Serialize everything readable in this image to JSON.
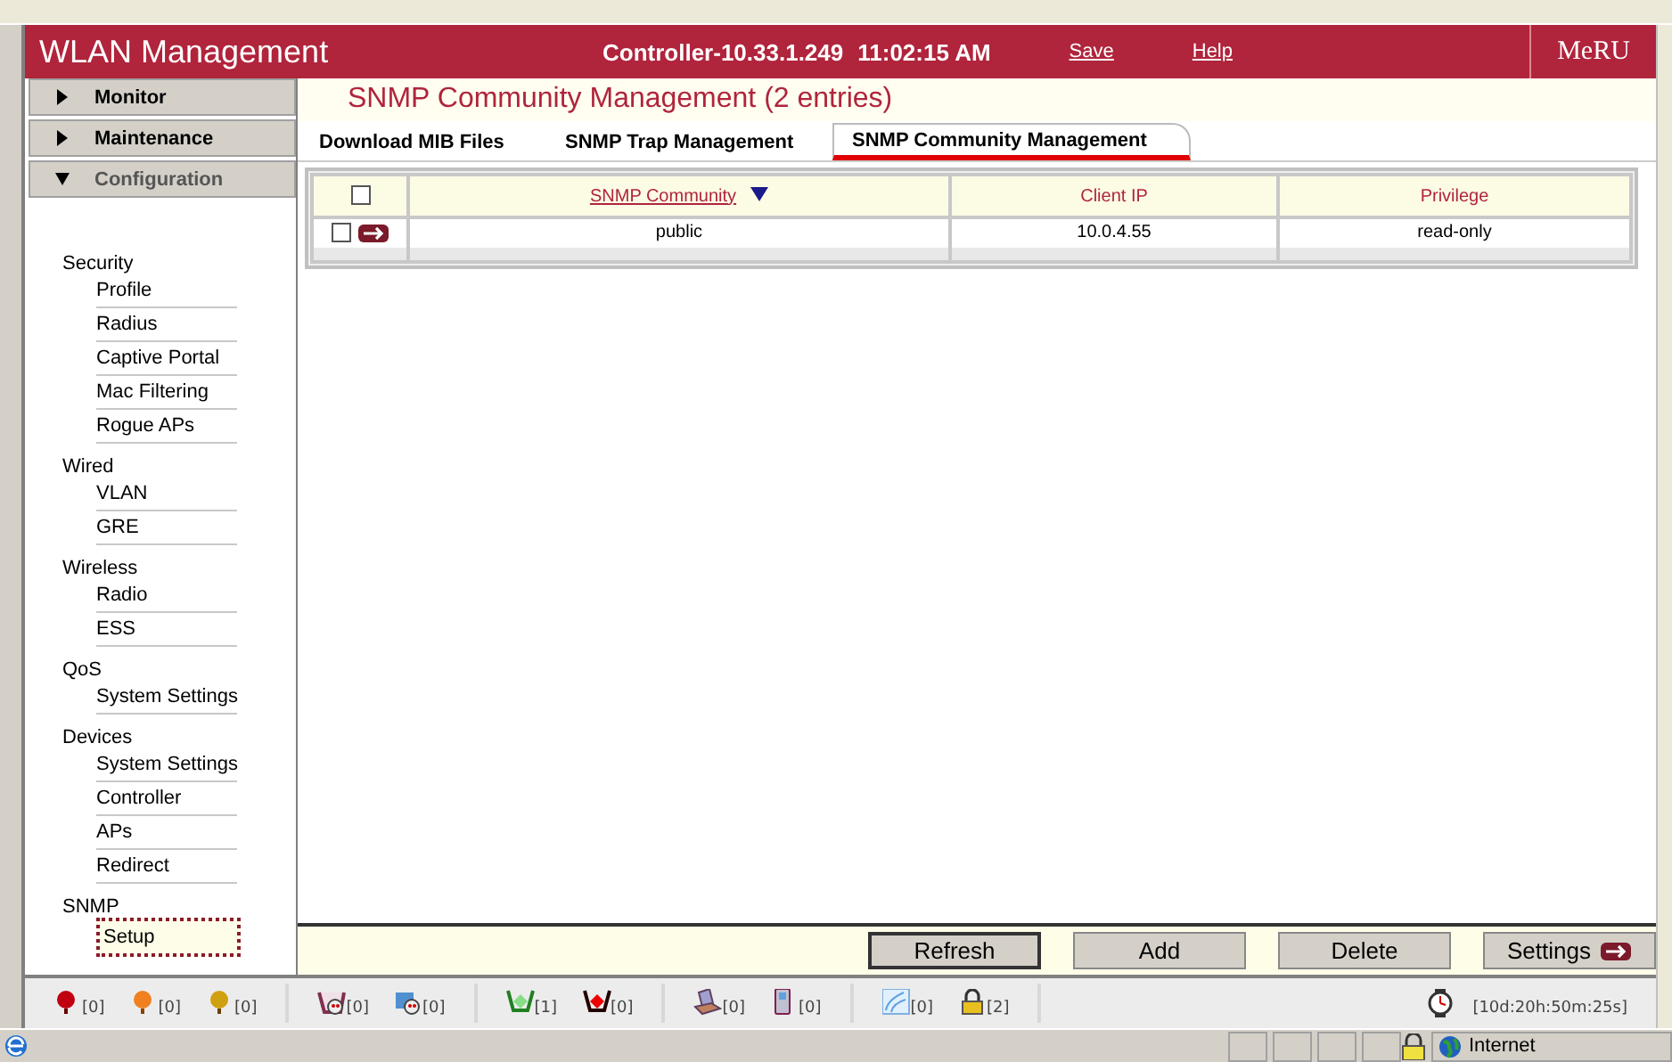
{
  "header": {
    "title": "WLAN Management",
    "controller": "Controller-10.33.1.249",
    "time": "11:02:15 AM",
    "links": [
      "Save",
      "Help"
    ],
    "logo": "MeRU"
  },
  "nav": [
    {
      "label": "Monitor",
      "expanded": false
    },
    {
      "label": "Maintenance",
      "expanded": false
    },
    {
      "label": "Configuration",
      "expanded": true
    }
  ],
  "menu": [
    {
      "label": "Security",
      "children": [
        {
          "label": "Profile",
          "selected": false
        },
        {
          "label": "Radius",
          "selected": false
        },
        {
          "label": "Captive Portal",
          "selected": false
        },
        {
          "label": "Mac Filtering",
          "selected": false
        },
        {
          "label": "Rogue APs",
          "selected": false
        }
      ]
    },
    {
      "label": "Wired",
      "children": [
        {
          "label": "VLAN",
          "selected": false
        },
        {
          "label": "GRE",
          "selected": false
        }
      ]
    },
    {
      "label": "Wireless",
      "children": [
        {
          "label": "Radio",
          "selected": false
        },
        {
          "label": "ESS",
          "selected": false
        }
      ]
    },
    {
      "label": "QoS",
      "children": [
        {
          "label": "System Settings",
          "selected": false
        }
      ]
    },
    {
      "label": "Devices",
      "children": [
        {
          "label": "System Settings",
          "selected": false
        },
        {
          "label": "Controller",
          "selected": false
        },
        {
          "label": "APs",
          "selected": false
        },
        {
          "label": "Redirect",
          "selected": false
        }
      ]
    },
    {
      "label": "SNMP",
      "children": [
        {
          "label": "Setup",
          "selected": true
        }
      ]
    }
  ],
  "page_title": "SNMP Community Management (2 entries)",
  "tabs": [
    {
      "label": "Download MIB Files",
      "selected": false
    },
    {
      "label": "SNMP Trap Management",
      "selected": false
    },
    {
      "label": "SNMP Community Management",
      "selected": true
    }
  ],
  "table": {
    "select_all": {
      "checked": false
    },
    "columns": [
      {
        "label": "SNMP Community",
        "sorted": true
      },
      {
        "label": "Client IP",
        "sorted": false
      },
      {
        "label": "Privilege",
        "sorted": false
      }
    ],
    "rows": [
      {
        "checked": false,
        "cells": [
          "public",
          "10.0.4.55",
          "read-only"
        ]
      }
    ]
  },
  "buttons": [
    "Refresh",
    "Add",
    "Delete",
    "Settings"
  ],
  "status_groups": [
    [
      {
        "kind": "alarm-critical",
        "count": "[0]"
      },
      {
        "kind": "alarm-major",
        "count": "[0]"
      },
      {
        "kind": "alarm-minor",
        "count": "[0]"
      }
    ],
    [
      {
        "kind": "rogue-ap",
        "count": "[0]"
      },
      {
        "kind": "rogue-client",
        "count": "[0]"
      }
    ],
    [
      {
        "kind": "ap-up",
        "count": "[1]"
      },
      {
        "kind": "ap-down",
        "count": "[0]"
      }
    ],
    [
      {
        "kind": "laptop",
        "count": "[0]"
      },
      {
        "kind": "phone",
        "count": "[0]"
      }
    ],
    [
      {
        "kind": "wireless",
        "count": "[0]"
      },
      {
        "kind": "lock",
        "count": "[2]"
      }
    ],
    [
      {
        "kind": "uptime",
        "count": "[10d:20h:50m:25s]"
      }
    ]
  ],
  "browser_status": {
    "zone": "Internet"
  }
}
